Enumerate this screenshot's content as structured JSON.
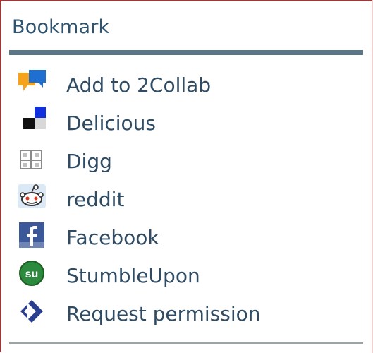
{
  "widget": {
    "title": "Bookmark"
  },
  "items": [
    {
      "label": "Add to 2Collab",
      "icon": "2collab-icon"
    },
    {
      "label": "Delicious",
      "icon": "delicious-icon"
    },
    {
      "label": "Digg",
      "icon": "digg-icon"
    },
    {
      "label": "reddit",
      "icon": "reddit-icon"
    },
    {
      "label": "Facebook",
      "icon": "facebook-icon"
    },
    {
      "label": "StumbleUpon",
      "icon": "stumbleupon-icon"
    },
    {
      "label": "Request permission",
      "icon": "request-permission-icon"
    }
  ],
  "colors": {
    "border": "#d21f26",
    "title": "#2f5470",
    "rule": "#5b7686",
    "link": "#2f4c64"
  }
}
